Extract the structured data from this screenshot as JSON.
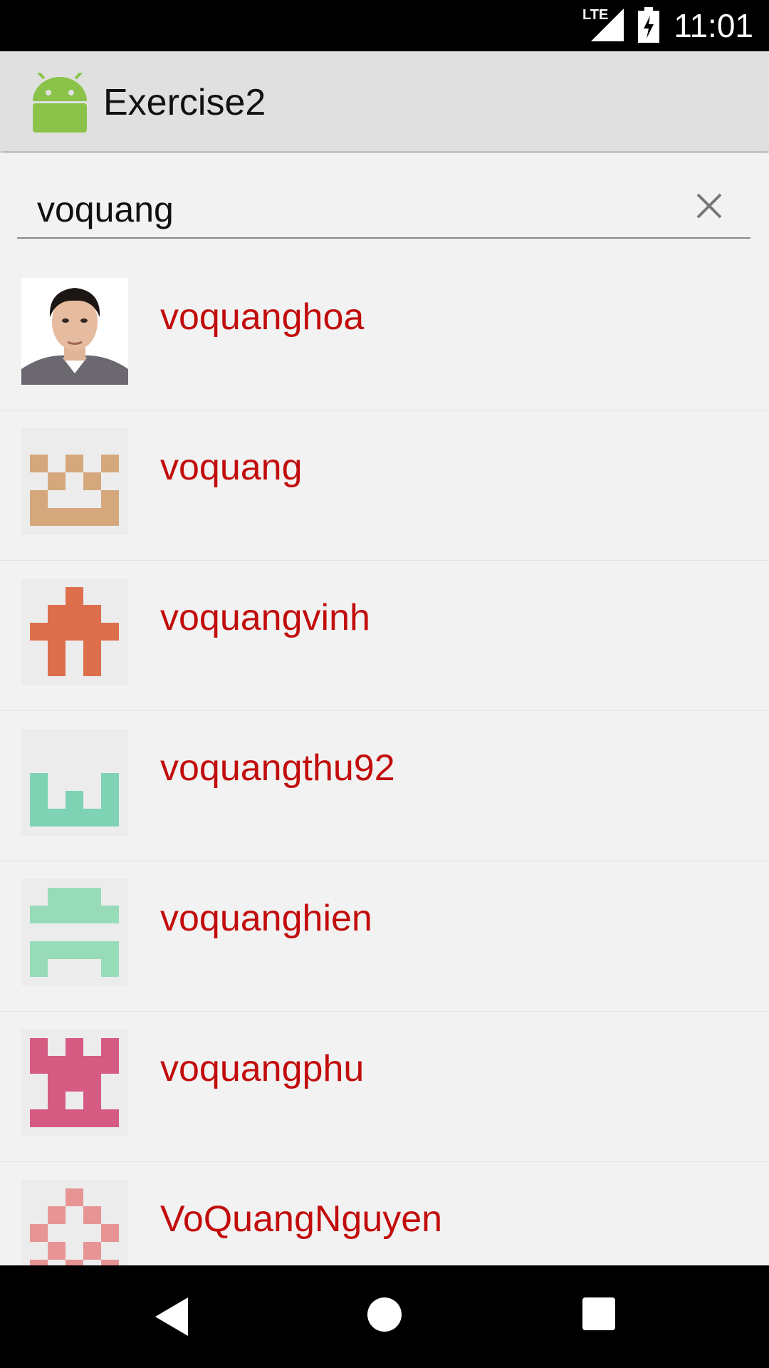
{
  "status_bar": {
    "network": "LTE",
    "time": "11:01"
  },
  "app_bar": {
    "title": "Exercise2",
    "icon": "android-logo-icon"
  },
  "search": {
    "value": "voquang"
  },
  "results": [
    {
      "name": "voquanghoa",
      "avatar": "photo"
    },
    {
      "name": "voquang",
      "avatar": "identicon",
      "color": "#d4a77c"
    },
    {
      "name": "voquangvinh",
      "avatar": "identicon",
      "color": "#dd6f4d"
    },
    {
      "name": "voquangthu92",
      "avatar": "identicon",
      "color": "#7dd3b4"
    },
    {
      "name": "voquanghien",
      "avatar": "identicon",
      "color": "#97dbb8"
    },
    {
      "name": "voquangphu",
      "avatar": "identicon",
      "color": "#d65b83"
    },
    {
      "name": "VoQuangNguyen",
      "avatar": "identicon",
      "color": "#e79494"
    }
  ],
  "colors": {
    "name_text": "#c20c0c",
    "app_bar": "#e0e0e0",
    "background": "#f2f2f2"
  }
}
